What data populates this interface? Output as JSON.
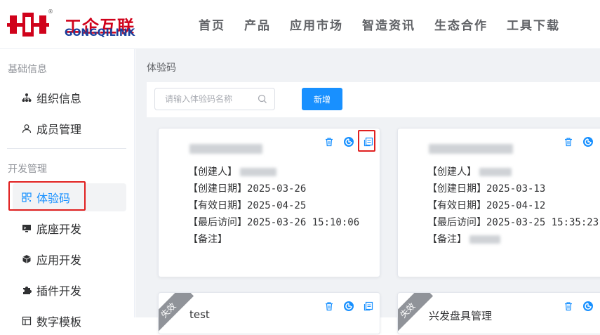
{
  "brand": {
    "name_cn": "工企互联",
    "name_en": "GONGQILINK",
    "reg": "®"
  },
  "nav": [
    "首页",
    "产品",
    "应用市场",
    "智造资讯",
    "生态合作",
    "工具下载"
  ],
  "sidebar": {
    "sections": [
      {
        "title": "基础信息",
        "items": [
          {
            "label": "组织信息",
            "icon": "org-chart-icon"
          },
          {
            "label": "成员管理",
            "icon": "user-icon"
          }
        ]
      },
      {
        "title": "开发管理",
        "items": [
          {
            "label": "体验码",
            "icon": "qrcode-icon",
            "active": true
          },
          {
            "label": "底座开发",
            "icon": "monitor-icon"
          },
          {
            "label": "应用开发",
            "icon": "cube-icon"
          },
          {
            "label": "插件开发",
            "icon": "puzzle-icon"
          },
          {
            "label": "数字模板",
            "icon": "template-icon"
          }
        ]
      }
    ]
  },
  "breadcrumb": "体验码",
  "search": {
    "placeholder": "请输入体验码名称"
  },
  "add_button": "新增",
  "cards": [
    {
      "name": "",
      "fields": [
        {
          "label": "【创建人】",
          "value": ""
        },
        {
          "label": "【创建日期】",
          "value": "2025-03-26"
        },
        {
          "label": "【有效日期】",
          "value": "2025-04-25"
        },
        {
          "label": "【最后访问】",
          "value": "2025-03-26 15:10:06"
        },
        {
          "label": "【备注】",
          "value": ""
        }
      ],
      "expired": false
    },
    {
      "name": "",
      "fields": [
        {
          "label": "【创建人】",
          "value": ""
        },
        {
          "label": "【创建日期】",
          "value": "2025-03-13"
        },
        {
          "label": "【有效日期】",
          "value": "2025-04-12"
        },
        {
          "label": "【最后访问】",
          "value": "2025-03-25 15:35:23"
        },
        {
          "label": "【备注】",
          "value": ""
        }
      ],
      "expired": false
    },
    {
      "name": "test",
      "fields": [],
      "expired": true,
      "ribbon": "失效"
    },
    {
      "name": "兴发盘具管理",
      "fields": [],
      "expired": true,
      "ribbon": "失效"
    }
  ],
  "colors": {
    "primary": "#1890ff",
    "brand_red": "#d0021b",
    "brand_blue": "#1a3f9c",
    "highlight": "#e02020"
  }
}
